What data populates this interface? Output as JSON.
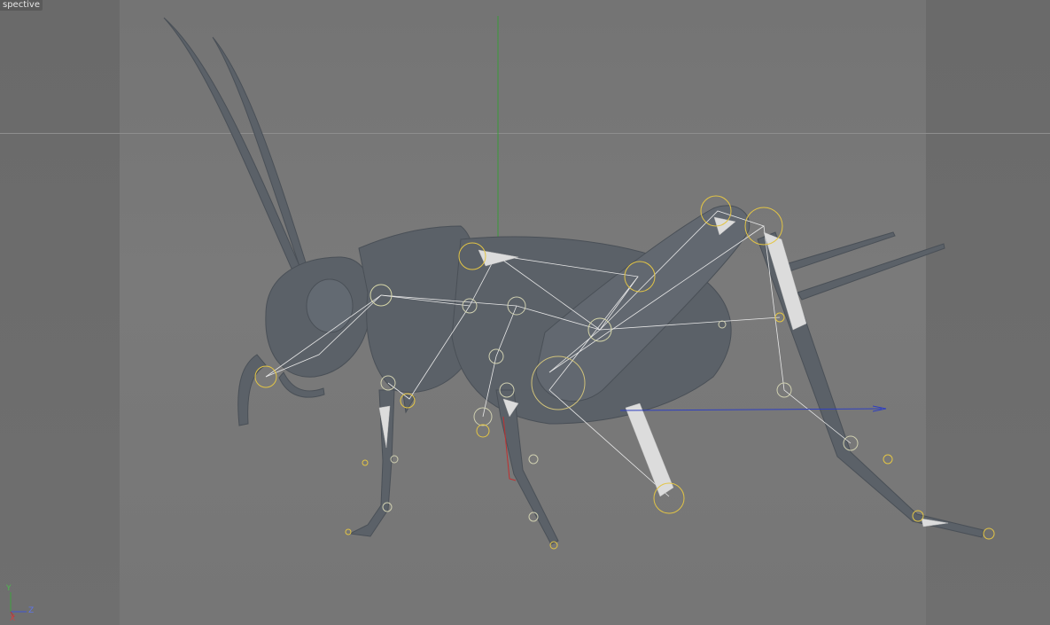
{
  "viewport": {
    "label": "spective",
    "axis_gizmo": {
      "y": "Y",
      "z": "Z",
      "x": "X"
    },
    "colors": {
      "background": "#6e6e6e",
      "safe_frame": "#787878",
      "model": "#5b6168",
      "bones": "#e8e8e8",
      "joints": "#e3c545",
      "axis_y": "#3fa13f",
      "axis_z": "#2f3fc0",
      "axis_x": "#c03030"
    }
  },
  "scene": {
    "object": "cricket-model",
    "rig": "skeleton-bones"
  }
}
